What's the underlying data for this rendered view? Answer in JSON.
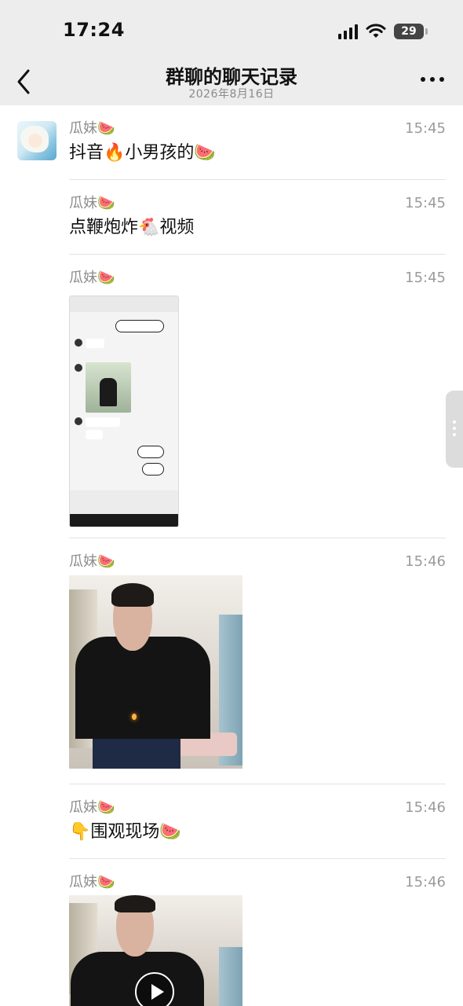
{
  "status_bar": {
    "time": "17:24",
    "battery": "29"
  },
  "header": {
    "title": "群聊的聊天记录",
    "subtitle": "2026年8月16日"
  },
  "messages": [
    {
      "sender": "瓜妹🍉",
      "time": "15:45",
      "type": "text",
      "text": "抖音🔥小男孩的🍉"
    },
    {
      "sender": "瓜妹🍉",
      "time": "15:45",
      "type": "text",
      "text": "点鞭炮炸🐔视频"
    },
    {
      "sender": "瓜妹🍉",
      "time": "15:45",
      "type": "image"
    },
    {
      "sender": "瓜妹🍉",
      "time": "15:46",
      "type": "image"
    },
    {
      "sender": "瓜妹🍉",
      "time": "15:46",
      "type": "text",
      "text": "👇围观现场🍉"
    },
    {
      "sender": "瓜妹🍉",
      "time": "15:46",
      "type": "video"
    }
  ]
}
